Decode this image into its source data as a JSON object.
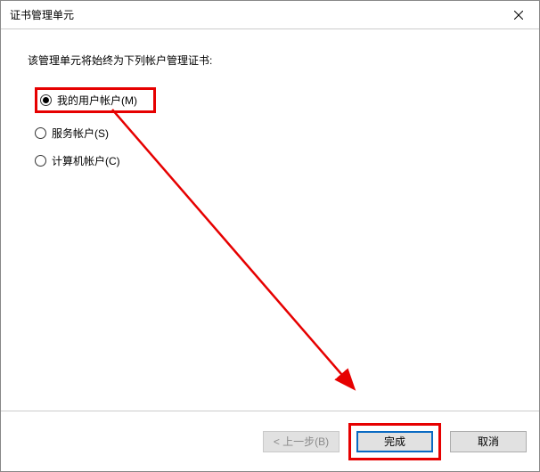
{
  "window": {
    "title": "证书管理单元"
  },
  "description": "该管理单元将始终为下列帐户管理证书:",
  "options": {
    "my_user_account": "我的用户帐户(M)",
    "service_account": "服务帐户(S)",
    "computer_account": "计算机帐户(C)"
  },
  "buttons": {
    "back": "< 上一步(B)",
    "finish": "完成",
    "cancel": "取消"
  }
}
